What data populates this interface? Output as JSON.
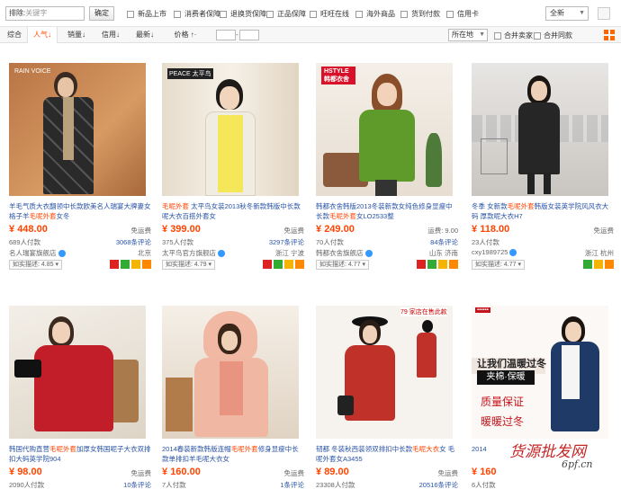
{
  "filter": {
    "search_prefix": "排除:",
    "search_placeholder": "关键字",
    "confirm_label": "确定",
    "checkboxes": [
      "新品上市",
      "消费者保障",
      "退换货保障",
      "正品保障",
      "旺旺在线",
      "海外商品",
      "货到付款",
      "信用卡"
    ],
    "scope_value": "全新"
  },
  "sort": {
    "tabs": [
      "综合",
      "人气↓",
      "销量↓",
      "信用↓",
      "最新↓",
      "价格 ↑·"
    ],
    "location": "所在地",
    "merge_sellers": "合并卖家",
    "merge_items": "合并同款"
  },
  "products": [
    {
      "title_plain": "羊毛气质大衣翻领中长款欧美名人瑞宴大牌妻女格子羊",
      "title_hl": "毛呢外套",
      "title_tail": "女冬",
      "price": "448.00",
      "shipping": "免运费",
      "sold": "689人付款",
      "comments": "3068条评论",
      "shop": "名人瑞宴旗舰店",
      "location": "北京",
      "rating": "如实描述: 4.85",
      "brand": "RAIN VOICE"
    },
    {
      "title_plain": "",
      "title_hl": "毛呢外套",
      "title_tail": " 太平鸟女装2013秋冬新款韩版中长款呢大衣百搭外套女",
      "price": "399.00",
      "shipping": "免运费",
      "sold": "375人付款",
      "comments": "3297条评论",
      "shop": "太平鸟官方旗舰店",
      "location": "浙江 宁波",
      "rating": "如实描述: 4.79",
      "brand": "PEACE 太平鸟"
    },
    {
      "title_plain": "韩都衣舍韩版2013冬装新款女纯色修身显瘦中长款",
      "title_hl": "毛呢外套",
      "title_tail": "女LO2533整",
      "price": "249.00",
      "shipping": "运费: 9.00",
      "sold": "70人付款",
      "comments": "84条评论",
      "shop": "韩都衣舍旗舰店",
      "location": "山东 济南",
      "rating": "如实描述: 4.77",
      "brand": "HSTYLE 韩都衣舍"
    },
    {
      "title_plain": "冬季 女新款",
      "title_hl": "毛呢外套",
      "title_tail": "韩版女装英学院风风衣大码 厚款呢大衣H7",
      "price": "118.00",
      "shipping": "免运费",
      "sold": "23人付款",
      "comments": "",
      "shop": "cxy1989725",
      "location": "浙江 杭州",
      "rating": "如实描述: 4.77",
      "brand": ""
    },
    {
      "title_plain": "韩国代购直营",
      "title_hl": "毛呢外套",
      "title_tail": "加厚女韩国呢子大衣双排扣大码英学院904",
      "price": "98.00",
      "shipping": "免运费",
      "sold": "2090人付款",
      "comments": "10条评论",
      "shop": "",
      "location": "",
      "rating": "",
      "brand": ""
    },
    {
      "title_plain": "2014春装新款韩版连帽",
      "title_hl": "毛呢外套",
      "title_tail": "修身显瘦中长款单排扣羊毛呢大衣女",
      "price": "160.00",
      "shipping": "免运费",
      "sold": "7人付款",
      "comments": "1条评论",
      "shop": "",
      "location": "",
      "rating": "",
      "brand": ""
    },
    {
      "title_plain": "韧都 冬装秋西装领双排扣中长款",
      "title_hl": "毛呢大衣",
      "title_tail": "女 毛呢外套女A3455",
      "price": "89.00",
      "shipping": "免运费",
      "sold": "23308人付款",
      "comments": "20516条评论",
      "shop": "",
      "location": "",
      "rating": "",
      "brand": "79 家店在售此款"
    },
    {
      "title_plain": "2014",
      "title_hl": "",
      "title_tail": "",
      "price": "160",
      "shipping": "",
      "sold": "6人付款",
      "comments": "",
      "shop": "",
      "location": "",
      "rating": "",
      "brand": "让我们温暖过冬",
      "ad_lines": [
        "让我们温暖过冬",
        "夹棉·保暖",
        "质量保证",
        "暖暖过冬"
      ]
    }
  ],
  "watermark": {
    "text": "货源批发网",
    "url": "6pf.cn"
  },
  "colors": {
    "accent": "#ff4400",
    "link": "#2953a6"
  }
}
